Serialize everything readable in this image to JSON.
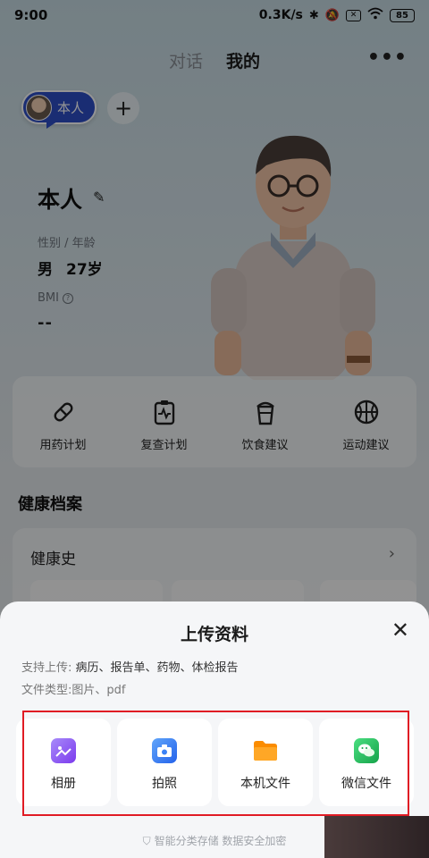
{
  "status": {
    "time": "9:00",
    "speed": "0.3K/s",
    "battery": "85"
  },
  "tabs": [
    {
      "label": "对话"
    },
    {
      "label": "我的"
    }
  ],
  "profile": {
    "chip_label": "本人",
    "name": "本人",
    "gender_age_label": "性别 / 年龄",
    "gender": "男",
    "age": "27岁",
    "bmi_label": "BMI",
    "bmi_value": "--"
  },
  "actions": [
    {
      "label": "用药计划",
      "icon": "pill-icon"
    },
    {
      "label": "复查计划",
      "icon": "clipboard-icon"
    },
    {
      "label": "饮食建议",
      "icon": "cup-icon"
    },
    {
      "label": "运动建议",
      "icon": "basketball-icon"
    }
  ],
  "health": {
    "section_title": "健康档案",
    "history_label": "健康史"
  },
  "upload": {
    "title": "上传资料",
    "support_prefix": "支持上传:",
    "support_items": "病历、报告单、药物、体检报告",
    "filetype_prefix": "文件类型:",
    "filetype_items": "图片、pdf",
    "options": [
      {
        "label": "相册",
        "color": "#8b5cf6"
      },
      {
        "label": "拍照",
        "color": "#3b82f6"
      },
      {
        "label": "本机文件",
        "color": "#fb8c00"
      },
      {
        "label": "微信文件",
        "color": "#22c55e"
      }
    ],
    "footer": "智能分类存储 数据安全加密"
  }
}
